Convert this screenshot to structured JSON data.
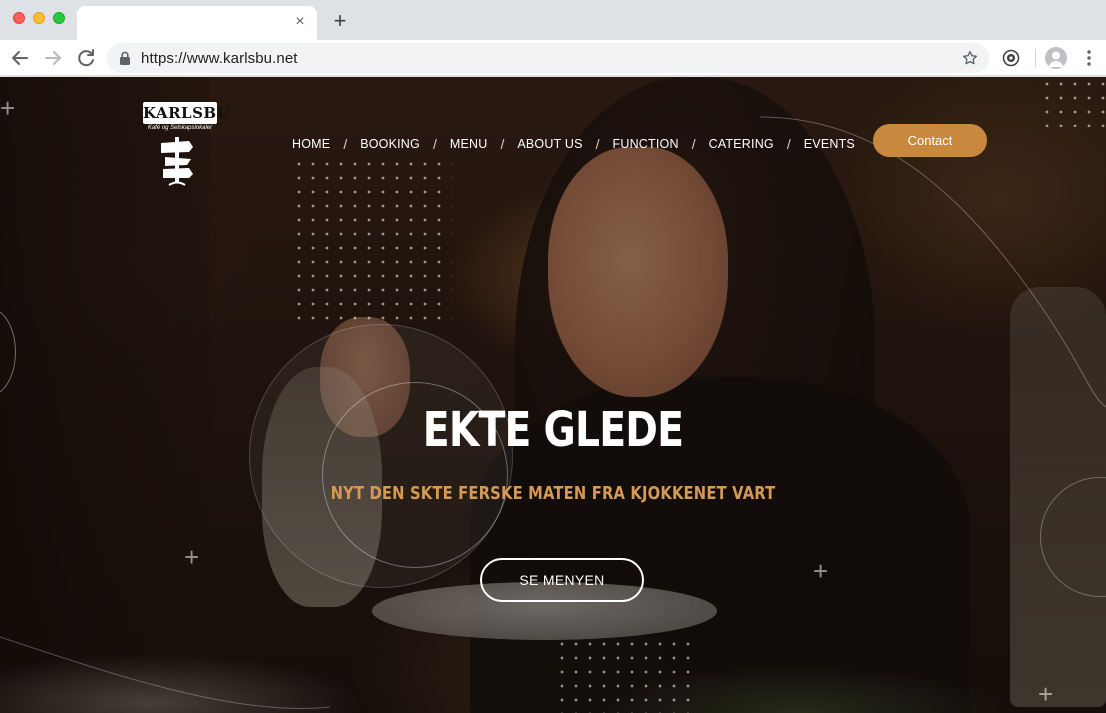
{
  "browser": {
    "url": "https://www.karlsbu.net",
    "tab_title": "",
    "tab_close_glyph": "×",
    "new_tab_glyph": "+"
  },
  "site": {
    "logo": {
      "wordmark": "KARLSBU",
      "tagline": "Kafé og Selskapslokaler"
    },
    "nav": {
      "items": [
        "HOME",
        "BOOKING",
        "MENU",
        "ABOUT US",
        "FUNCTION",
        "CATERING",
        "EVENTS"
      ],
      "separator": "/",
      "contact_label": "Contact"
    },
    "hero": {
      "title": "EKTE GLEDE",
      "subtitle": "NYT DEN SKTE FERSKE MATEN FRA KJOKKENET VART",
      "cta_label": "SE MENYEN"
    }
  },
  "colors": {
    "accent": "#c8893f",
    "subtitle": "#d49a55",
    "chrome_bg": "#dee1e6"
  },
  "icons": [
    "back-arrow-icon",
    "forward-arrow-icon",
    "reload-icon",
    "lock-icon",
    "star-icon",
    "extension-icon",
    "profile-icon",
    "menu-kebab-icon",
    "close-icon",
    "plus-icon"
  ]
}
